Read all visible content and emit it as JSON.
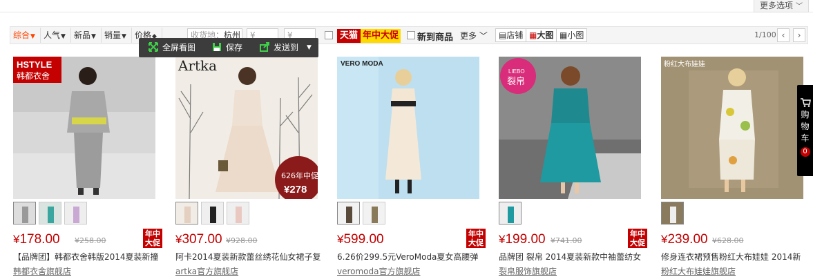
{
  "top": {
    "more_options": "更多选项"
  },
  "filterbar": {
    "sort": [
      {
        "label": "综合",
        "active": true
      },
      {
        "label": "人气"
      },
      {
        "label": "新品"
      },
      {
        "label": "销量"
      },
      {
        "label": "价格"
      }
    ],
    "ship_from_label": "收货地：",
    "ship_from_value": "杭州",
    "price_min": "¥",
    "price_max": "¥",
    "tmall": "天猫",
    "mid_year_sale": "年中大促",
    "new_goods": "新到商品",
    "more": "更多",
    "view_store": "店铺",
    "view_large": "大图",
    "view_small": "小图",
    "page": "1/100"
  },
  "floating_toolbar": {
    "fullscreen": "全屏看图",
    "save": "保存",
    "send_to": "发送到"
  },
  "products": [
    {
      "price": "178.00",
      "old_price": "¥258.00",
      "promo": true,
      "title": "【品牌团】韩都衣舍韩版2014夏装新撞",
      "shop": "韩都衣舍旗舰店",
      "brand": "HSTYLE 韩都衣舍",
      "thumb_count": 3
    },
    {
      "price": "307.00",
      "old_price": "¥928.00",
      "promo": false,
      "title": "阿卡2014夏装新款蕾丝绣花仙女裙子复",
      "shop": "artka官方旗舰店",
      "brand": "Artka",
      "badge": "626年中促 ¥278",
      "thumb_count": 3
    },
    {
      "price": "599.00",
      "old_price": "",
      "promo": true,
      "title": "6.26价299.5元VeroModa夏女高腰弹",
      "shop": "veromoda官方旗舰店",
      "brand": "VERO MODA",
      "thumb_count": 2
    },
    {
      "price": "199.00",
      "old_price": "¥741.00",
      "promo": true,
      "title": "品牌团 裂帛 2014夏装新款中袖蕾纺女",
      "shop": "裂帛服饰旗舰店",
      "brand": "LIEBO 裂帛",
      "thumb_count": 1
    },
    {
      "price": "239.00",
      "old_price": "¥628.00",
      "promo": false,
      "title": "修身连衣裙预售粉红大布娃娃 2014新",
      "shop": "粉红大布娃娃旗舰店",
      "brand": "粉红大布娃娃",
      "thumb_count": 1
    }
  ],
  "promo_text": [
    "年中",
    "大促"
  ],
  "currency": "¥",
  "cart": {
    "label": [
      "购",
      "物",
      "车"
    ],
    "count": "0"
  },
  "colors": {
    "accent": "#c40000",
    "tmall_yellow": "#ffda00",
    "toolbar": "#3c3c3c"
  }
}
